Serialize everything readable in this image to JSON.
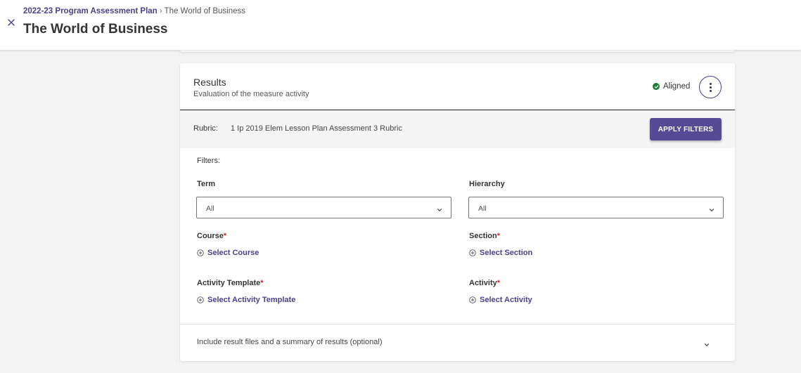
{
  "header": {
    "breadcrumb_parent": "2022-23 Program Assessment Plan",
    "breadcrumb_separator": "›",
    "breadcrumb_current": "The World of Business",
    "title": "The World of Business",
    "close_icon": "close-icon"
  },
  "results": {
    "title": "Results",
    "subtitle": "Evaluation of the measure activity",
    "status": "Aligned",
    "status_color": "#1e7d3a",
    "menu_icon": "kebab-icon"
  },
  "rubric": {
    "label": "Rubric:",
    "value": "1 Ip 2019 Elem Lesson Plan Assessment 3 Rubric",
    "apply_button": "APPLY FILTERS",
    "accent": "#574a94"
  },
  "filters": {
    "label": "Filters:",
    "term": {
      "label": "Term",
      "value": "All"
    },
    "hierarchy": {
      "label": "Hierarchy",
      "value": "All"
    },
    "course": {
      "label": "Course",
      "required": "*",
      "link": "Select Course"
    },
    "section": {
      "label": "Section",
      "required": "*",
      "link": "Select Section"
    },
    "activity_template": {
      "label": "Activity Template",
      "required": "*",
      "link": "Select Activity Template"
    },
    "activity": {
      "label": "Activity",
      "required": "*",
      "link": "Select Activity"
    }
  },
  "optional": {
    "text": "Include result files and a summary of results (optional)"
  }
}
